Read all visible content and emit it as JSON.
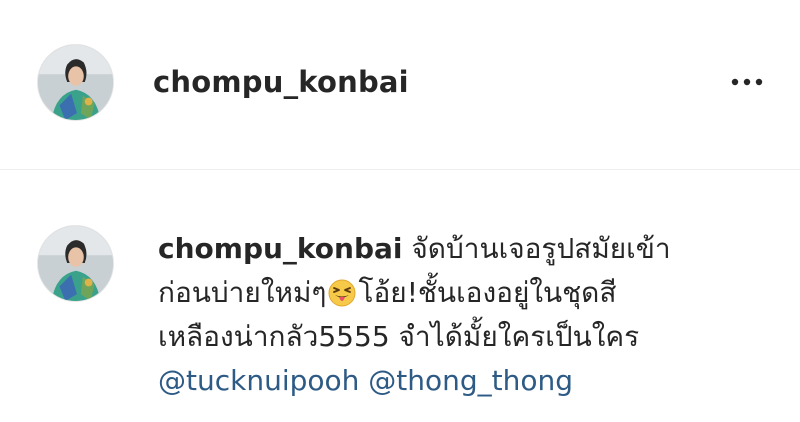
{
  "post_header": {
    "username": "chompu_konbai",
    "avatar_icon": "profile-photo",
    "more_icon": "more-options-icon"
  },
  "caption": {
    "username": "chompu_konbai",
    "line1_text": " จัดบ้านเจอรูปสมัยเข้า",
    "line2_before_emoji": "ก่อนบ่ายใหม่ๆ",
    "emoji_icon": "squinting-face-with-tongue-emoji",
    "line2_after_emoji": "โอ้ย!ชั้นเองอยู่ในชุดสี",
    "line3_text": "เหลืองน่ากลัว5555 จำได้มั้ยใครเป็นใคร",
    "mentions": [
      "@tucknuipooh",
      "@thong_thong"
    ]
  },
  "colors": {
    "text": "#262626",
    "mention": "#2e5b85",
    "divider": "#efefef"
  }
}
